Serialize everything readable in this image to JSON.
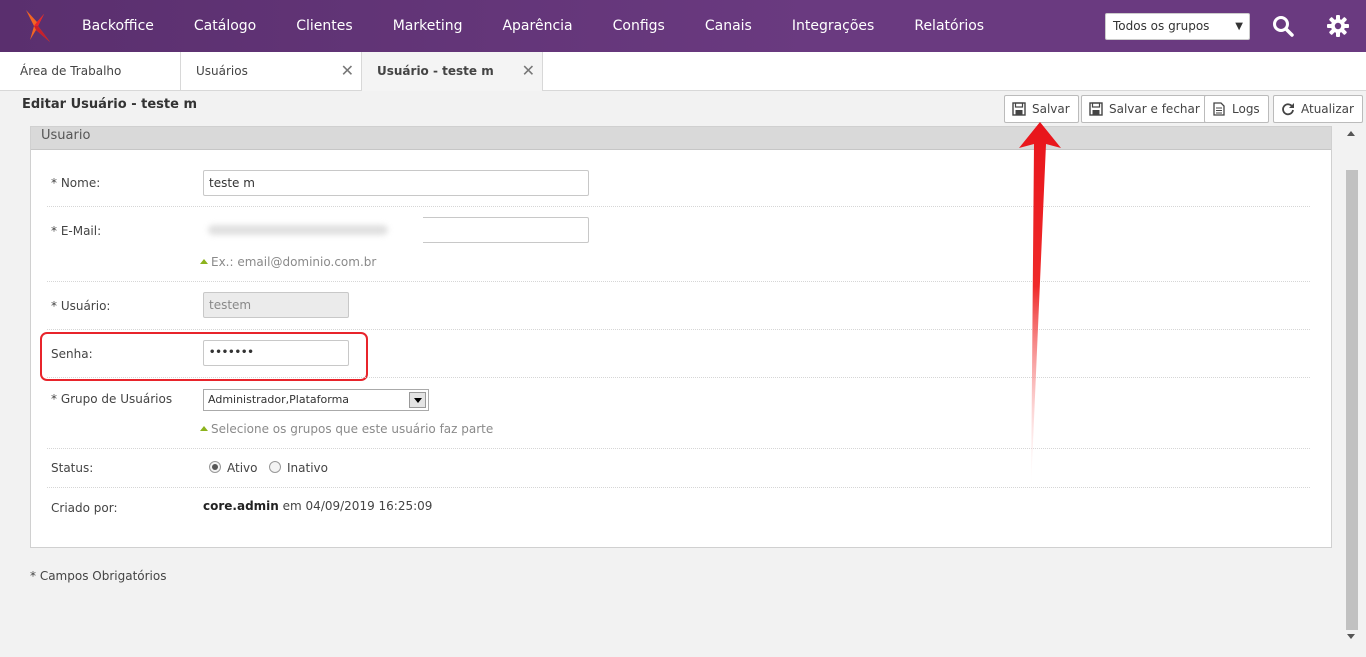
{
  "nav": {
    "items": [
      "Backoffice",
      "Catálogo",
      "Clientes",
      "Marketing",
      "Aparência",
      "Configs",
      "Canais",
      "Integrações",
      "Relatórios"
    ],
    "group_select": "Todos os grupos",
    "search_icon": "search-icon",
    "settings_icon": "gear-icon"
  },
  "tabs": [
    {
      "label": "Área de Trabalho",
      "closable": false
    },
    {
      "label": "Usuários",
      "closable": true
    },
    {
      "label": "Usuário - teste m",
      "closable": true,
      "active": true
    }
  ],
  "page": {
    "title": "Editar Usuário - teste m",
    "buttons": {
      "save": "Salvar",
      "save_close": "Salvar e fechar",
      "logs": "Logs",
      "refresh": "Atualizar"
    }
  },
  "form": {
    "section_title": "Usuario",
    "name_label": "* Nome:",
    "name_value": "teste m",
    "email_label": "* E-Mail:",
    "email_hint": "Ex.: email@dominio.com.br",
    "user_label": "* Usuário:",
    "user_value": "testem",
    "password_label": "Senha:",
    "password_value": "•••••••",
    "group_label": "* Grupo de Usuários",
    "group_value": "Administrador,Plataforma",
    "group_hint": "Selecione os grupos que este usuário faz parte",
    "status_label": "Status:",
    "status_options": [
      "Ativo",
      "Inativo"
    ],
    "status_selected": "Ativo",
    "created_label": "Criado por:",
    "created_by": "core.admin",
    "created_rest": "em 04/09/2019 16:25:09"
  },
  "footnote": "* Campos Obrigatórios",
  "colors": {
    "nav_bg": "#5a2f6e",
    "accent_orange": "#f26522",
    "highlight_red": "#e8242b"
  }
}
